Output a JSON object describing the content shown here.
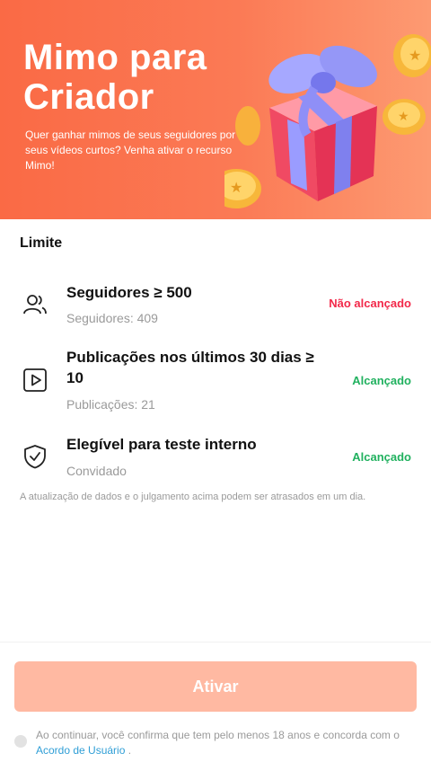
{
  "banner": {
    "title": "Mimo para Criador",
    "subtitle": "Quer ganhar mimos de seus seguidores por seus vídeos curtos? Venha ativar o recurso Mimo!"
  },
  "section_title": "Limite",
  "requirements": [
    {
      "icon": "users-icon",
      "title": "Seguidores ≥ 500",
      "subtitle": "Seguidores: 409",
      "status": "Não alcançado",
      "status_color": "#f2294a"
    },
    {
      "icon": "video-play-icon",
      "title": "Publicações nos últimos 30 dias ≥ 10",
      "subtitle": "Publicações: 21",
      "status": "Alcançado",
      "status_color": "#21b15f"
    },
    {
      "icon": "shield-check-icon",
      "title": "Elegível para teste interno",
      "subtitle": "Convidado",
      "status": "Alcançado",
      "status_color": "#21b15f"
    }
  ],
  "note": "A atualização de dados e o julgamento acima podem ser atrasados em um dia.",
  "activate_label": "Ativar",
  "agreement": {
    "text": "Ao continuar, você confirma que tem pelo menos 18 anos e concorda com o ",
    "link": "Acordo de Usuário",
    "suffix": " ."
  },
  "colors": {
    "brand": "#fa6a45",
    "button_disabled": "#ffb9a2",
    "link": "#2f9ed6"
  }
}
